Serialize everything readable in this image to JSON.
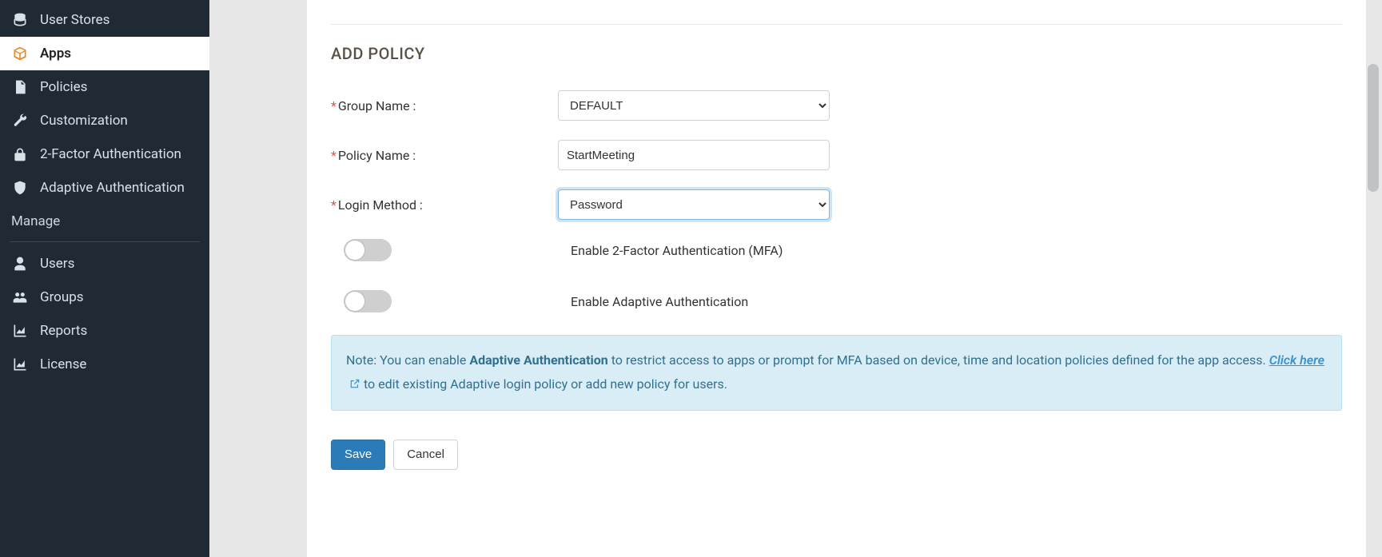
{
  "sidebar": {
    "items": [
      {
        "label": "User Stores",
        "icon": "database-icon"
      },
      {
        "label": "Apps",
        "icon": "box-icon",
        "active": true
      },
      {
        "label": "Policies",
        "icon": "document-icon"
      },
      {
        "label": "Customization",
        "icon": "wrench-icon"
      },
      {
        "label": "2-Factor Authentication",
        "icon": "lock-icon"
      },
      {
        "label": "Adaptive Authentication",
        "icon": "shield-icon"
      }
    ],
    "section_label": "Manage",
    "manage_items": [
      {
        "label": "Users",
        "icon": "user-icon"
      },
      {
        "label": "Groups",
        "icon": "group-icon"
      },
      {
        "label": "Reports",
        "icon": "chart-icon"
      },
      {
        "label": "License",
        "icon": "chart-icon"
      }
    ]
  },
  "page": {
    "title": "ADD POLICY",
    "fields": {
      "group_name": {
        "label": "Group Name :",
        "value": "DEFAULT"
      },
      "policy_name": {
        "label": "Policy Name :",
        "value": "StartMeeting"
      },
      "login_method": {
        "label": "Login Method :",
        "value": "Password"
      }
    },
    "toggles": {
      "mfa": {
        "label": "Enable 2-Factor Authentication (MFA)",
        "on": false
      },
      "adaptive": {
        "label": "Enable Adaptive Authentication",
        "on": false
      }
    },
    "note": {
      "prefix": "Note: You can enable ",
      "bold": "Adaptive Authentication",
      "middle": " to restrict access to apps or prompt for MFA based on device, time and location policies defined for the app access. ",
      "link_text": "Click here",
      "suffix": " to edit existing Adaptive login policy or add new policy for users."
    },
    "buttons": {
      "save": "Save",
      "cancel": "Cancel"
    }
  }
}
